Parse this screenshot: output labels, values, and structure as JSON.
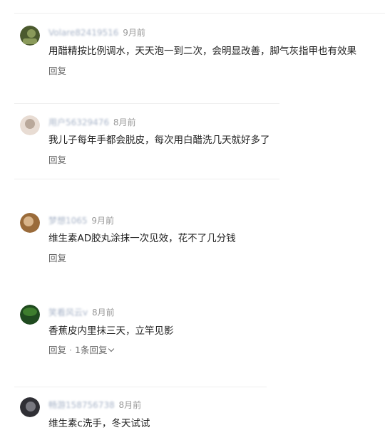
{
  "comments": [
    {
      "username": "Volare82419516",
      "time": "9月前",
      "text": "用醋精按比例调水，天天泡一到二次，会明显改善，脚气灰指甲也有效果",
      "reply_label": "回复",
      "avatar_colors": [
        "#4b5a2e",
        "#8a9a5a"
      ]
    },
    {
      "username": "用户56329476",
      "time": "8月前",
      "text": "我儿子每年手都会脱皮，每次用白醋洗几天就好多了",
      "reply_label": "回复",
      "avatar_colors": [
        "#b9a89a",
        "#e8dcd3"
      ]
    },
    {
      "username": "梦想1065",
      "time": "9月前",
      "text": "维生素AD胶丸涂抹一次见效，花不了几分钱",
      "reply_label": "回复",
      "avatar_colors": [
        "#9a6b3a",
        "#d8b48a"
      ]
    },
    {
      "username": "笑看风云v",
      "time": "8月前",
      "text": "香蕉皮内里抹三天，立竿见影",
      "reply_label": "回复",
      "reply_count_label": "1条回复",
      "avatar_colors": [
        "#1f4a1f",
        "#3e7d2e"
      ]
    },
    {
      "username": "畅游158756738",
      "time": "8月前",
      "text": "维生素c洗手，冬天试试",
      "avatar_colors": [
        "#2f2f35",
        "#77777f"
      ]
    }
  ]
}
